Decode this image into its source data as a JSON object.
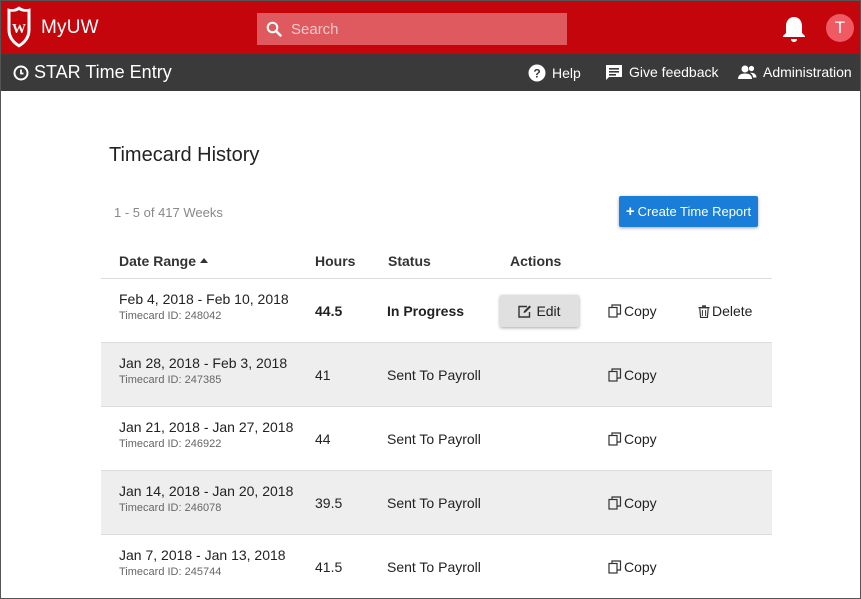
{
  "header": {
    "brand": "MyUW",
    "search_placeholder": "Search",
    "avatar_initial": "T"
  },
  "appbar": {
    "title": "STAR Time Entry",
    "links": {
      "help": "Help",
      "feedback": "Give feedback",
      "admin": "Administration"
    }
  },
  "page": {
    "title": "Timecard History",
    "range_count": "1 - 5 of 417 Weeks",
    "create_button": "Create Time Report"
  },
  "table": {
    "columns": {
      "date_range": "Date Range",
      "hours": "Hours",
      "status": "Status",
      "actions": "Actions"
    },
    "rows": [
      {
        "date": "Feb 4, 2018 - Feb 10, 2018",
        "tid": "Timecard ID: 248042",
        "hours": "44.5",
        "status": "In Progress",
        "edit": "Edit",
        "copy": "Copy",
        "delete": "Delete"
      },
      {
        "date": "Jan 28, 2018 - Feb 3, 2018",
        "tid": "Timecard ID: 247385",
        "hours": "41",
        "status": "Sent To Payroll",
        "copy": "Copy"
      },
      {
        "date": "Jan 21, 2018 - Jan 27, 2018",
        "tid": "Timecard ID: 246922",
        "hours": "44",
        "status": "Sent To Payroll",
        "copy": "Copy"
      },
      {
        "date": "Jan 14, 2018 - Jan 20, 2018",
        "tid": "Timecard ID: 246078",
        "hours": "39.5",
        "status": "Sent To Payroll",
        "copy": "Copy"
      },
      {
        "date": "Jan 7, 2018 - Jan 13, 2018",
        "tid": "Timecard ID: 245744",
        "hours": "41.5",
        "status": "Sent To Payroll",
        "copy": "Copy"
      }
    ]
  },
  "colors": {
    "brand_red": "#c5050c",
    "appbar_dark": "#3a3a3a",
    "primary_blue": "#1a7ed8"
  },
  "icons": {
    "crest": "uw-crest-icon",
    "search": "search-icon",
    "bell": "bell-icon",
    "clock": "clock-icon",
    "help": "help-icon",
    "feedback": "feedback-icon",
    "admin": "admin-icon",
    "edit": "edit-icon",
    "copy": "copy-icon",
    "delete": "trash-icon"
  }
}
